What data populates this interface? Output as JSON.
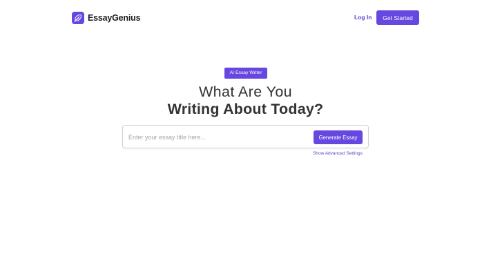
{
  "header": {
    "brand": "EssayGenius",
    "login_label": "Log In",
    "get_started_label": "Get Started"
  },
  "hero": {
    "badge": "AI Essay Writer",
    "headline_line1": "What Are You",
    "headline_line2": "Writing About Today?"
  },
  "search": {
    "value": "",
    "placeholder": "Enter your essay title here...",
    "button_label": "Generate Essay",
    "advanced_link": "Show Advanced Settings"
  },
  "theme": {
    "accent": "#6647e0",
    "link": "#5a44c9",
    "text": "#333338"
  },
  "icons": {
    "logo": "feather-icon"
  }
}
